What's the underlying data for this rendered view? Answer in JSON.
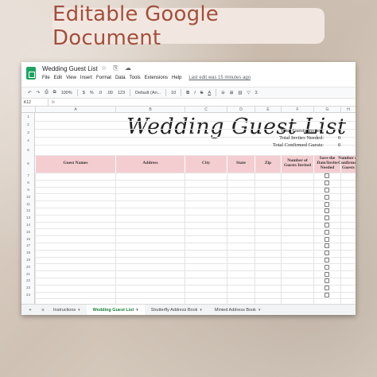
{
  "banner": {
    "text": "Editable Google Document"
  },
  "app": {
    "doc_title": "Wedding Guest List",
    "title_icons": "☆ ⎘ ☁",
    "menu": [
      "File",
      "Edit",
      "View",
      "Insert",
      "Format",
      "Data",
      "Tools",
      "Extensions",
      "Help"
    ],
    "last_edit": "Last edit was 15 minutes ago"
  },
  "toolbar": {
    "undo": "↶",
    "redo": "↷",
    "print": "⎙",
    "paint": "⧉",
    "zoom": "100%",
    "currency": "$",
    "percent": "%",
    "dec1": ".0",
    "dec2": ".00",
    "numfmt": "123",
    "font": "Default (Ari...",
    "size": "10",
    "bold": "B",
    "italic": "I",
    "strike": "S",
    "textcolor": "A",
    "link": "⊖",
    "comment": "⊞",
    "chart": "▥",
    "filter": "▽",
    "more": "Σ"
  },
  "formula": {
    "namebox": "K12",
    "fx": "fx"
  },
  "columns": [
    "A",
    "B",
    "C",
    "D",
    "E",
    "F",
    "G",
    "H"
  ],
  "sheet": {
    "title": "Wedding Guest List",
    "stats": [
      {
        "label": "Total Guests Invited:",
        "value": "0"
      },
      {
        "label": "Total Invites Needed:",
        "value": "0"
      },
      {
        "label": "Total Confirmed Guests:",
        "value": "0"
      }
    ],
    "headers": [
      "Guest Names",
      "Address",
      "City",
      "State",
      "Zip",
      "Number of Guests Invited",
      "Save the Date/Invite Needed",
      "Number of Confirmed Guests"
    ],
    "row_numbers": [
      "1",
      "2",
      "3",
      "4",
      "5",
      "6",
      "7",
      "8",
      "9",
      "10",
      "11",
      "12",
      "13",
      "14",
      "15",
      "16",
      "17",
      "18",
      "19",
      "20",
      "21",
      "22",
      "23",
      "24"
    ]
  },
  "tabs": {
    "add": "+",
    "list": "≡",
    "items": [
      {
        "label": "Instructions",
        "active": false
      },
      {
        "label": "Wedding Guest List",
        "active": true
      },
      {
        "label": "Shutterfly Address Book",
        "active": false
      },
      {
        "label": "Minted Address Book",
        "active": false
      }
    ]
  },
  "colors": {
    "banner_text": "#a34f3c",
    "banner_bg": "#f2e7e0",
    "header_pink": "#f4cdd0",
    "active_tab": "#188038",
    "sheets_green": "#1ea362"
  }
}
